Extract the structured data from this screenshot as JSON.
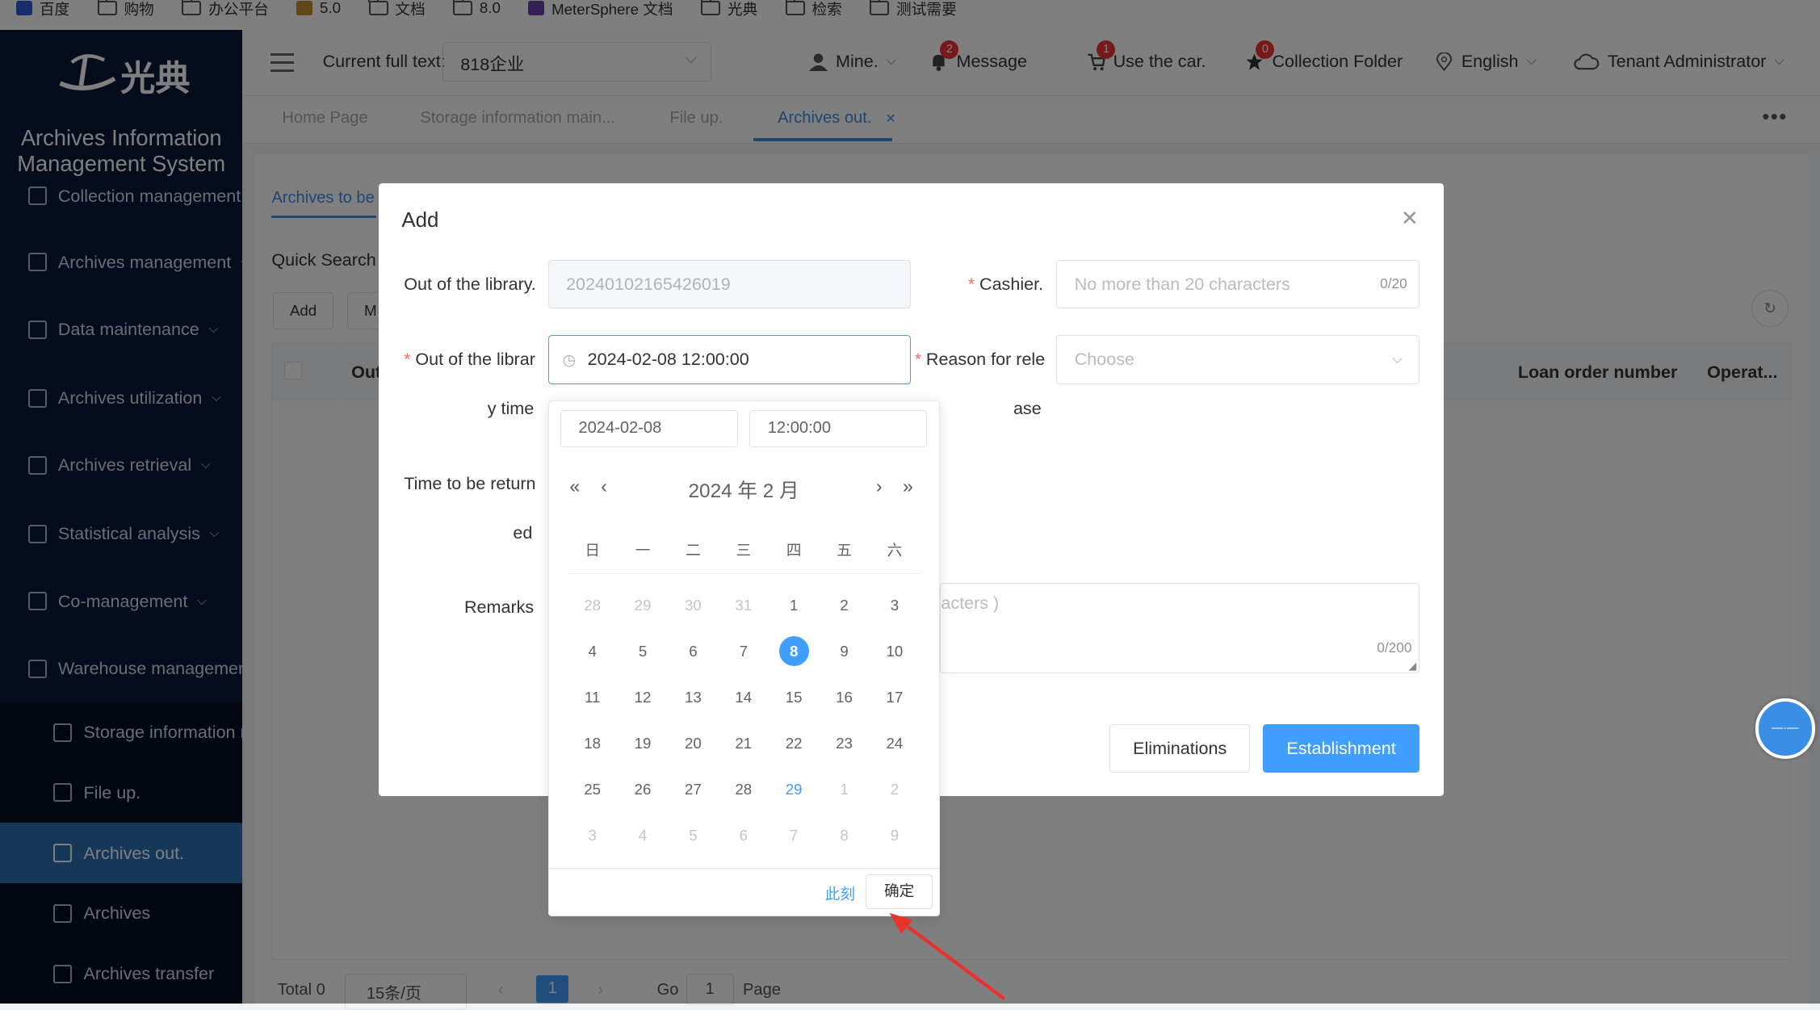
{
  "bookmarks": [
    {
      "label": "百度",
      "icon": "baidu-icon"
    },
    {
      "label": "购物",
      "icon": "folder-icon"
    },
    {
      "label": "办公平台",
      "icon": "folder-icon"
    },
    {
      "label": "5.0",
      "icon": "bookmark-icon"
    },
    {
      "label": "文档",
      "icon": "folder-icon"
    },
    {
      "label": "8.0",
      "icon": "folder-icon"
    },
    {
      "label": "MeterSphere 文档",
      "icon": "metersphere-icon"
    },
    {
      "label": "光典",
      "icon": "folder-icon"
    },
    {
      "label": "检索",
      "icon": "folder-icon"
    },
    {
      "label": "测试需要",
      "icon": "folder-icon"
    }
  ],
  "sidebar": {
    "logo_text": "光典",
    "title": "Archives Information Management System",
    "items": [
      {
        "label": "Collection management",
        "chevron": false
      },
      {
        "label": "Archives management",
        "chevron": true
      },
      {
        "label": "Data maintenance",
        "chevron": true
      },
      {
        "label": "Archives utilization",
        "chevron": true
      },
      {
        "label": "Archives retrieval",
        "chevron": true
      },
      {
        "label": "Statistical analysis",
        "chevron": true
      },
      {
        "label": "Co-management",
        "chevron": true
      },
      {
        "label": "Warehouse management",
        "chevron": true
      }
    ],
    "sub_items": [
      {
        "label": "Storage information maintenance",
        "active": false
      },
      {
        "label": "File up.",
        "active": false
      },
      {
        "label": "Archives out.",
        "active": true
      },
      {
        "label": "Archives",
        "active": false
      },
      {
        "label": "Archives transfer",
        "active": false
      }
    ]
  },
  "header": {
    "current_label": "Current full text:",
    "current_value": "818企业",
    "mine": "Mine.",
    "message": "Message",
    "message_badge": "2",
    "cart": "Use the car.",
    "cart_badge": "1",
    "collection": "Collection Folder",
    "collection_badge": "0",
    "language": "English",
    "user": "Tenant Administrator"
  },
  "tabs": [
    {
      "label": "Home Page",
      "active": false
    },
    {
      "label": "Storage information main...",
      "active": false
    },
    {
      "label": "File up.",
      "active": false
    },
    {
      "label": "Archives out.",
      "active": true
    }
  ],
  "content": {
    "sub_tab": "Archives to be",
    "quick_search": "Quick Search",
    "add_button": "Add",
    "second_button": "M",
    "columns": {
      "first": "Out",
      "loan": "Loan order number",
      "op": "Operat..."
    },
    "pager": {
      "total": "Total 0",
      "per_page": "15条/页",
      "page": "1",
      "go": "Go",
      "go_value": "1",
      "page_label": "Page"
    }
  },
  "dialog": {
    "title": "Add",
    "out_no_label": "Out of the library.",
    "out_no_value": "20240102165426019",
    "cashier_label": "Cashier.",
    "cashier_placeholder": "No more than 20 characters",
    "cashier_count": "0/20",
    "time_label_1": "Out of the librar",
    "time_label_2": "y time",
    "time_value": "2024-02-08 12:00:00",
    "reason_label_1": "Reason for rele",
    "reason_label_2": "ase",
    "reason_placeholder": "Choose",
    "return_label_1": "Time to be return",
    "return_label_2": "ed",
    "remarks_label": "Remarks",
    "remarks_placeholder": "acters )",
    "remarks_count": "0/200",
    "cancel": "Eliminations",
    "confirm": "Establishment"
  },
  "picker": {
    "date_value": "2024-02-08",
    "time_value": "12:00:00",
    "year_month": "2024 年  2 月",
    "weekdays": [
      "日",
      "一",
      "二",
      "三",
      "四",
      "五",
      "六"
    ],
    "weeks": [
      [
        {
          "d": "28",
          "k": "o"
        },
        {
          "d": "29",
          "k": "o"
        },
        {
          "d": "30",
          "k": "o"
        },
        {
          "d": "31",
          "k": "o"
        },
        {
          "d": "1",
          "k": ""
        },
        {
          "d": "2",
          "k": ""
        },
        {
          "d": "3",
          "k": ""
        }
      ],
      [
        {
          "d": "4",
          "k": ""
        },
        {
          "d": "5",
          "k": ""
        },
        {
          "d": "6",
          "k": ""
        },
        {
          "d": "7",
          "k": ""
        },
        {
          "d": "8",
          "k": "s"
        },
        {
          "d": "9",
          "k": ""
        },
        {
          "d": "10",
          "k": ""
        }
      ],
      [
        {
          "d": "11",
          "k": ""
        },
        {
          "d": "12",
          "k": ""
        },
        {
          "d": "13",
          "k": ""
        },
        {
          "d": "14",
          "k": ""
        },
        {
          "d": "15",
          "k": ""
        },
        {
          "d": "16",
          "k": ""
        },
        {
          "d": "17",
          "k": ""
        }
      ],
      [
        {
          "d": "18",
          "k": ""
        },
        {
          "d": "19",
          "k": ""
        },
        {
          "d": "20",
          "k": ""
        },
        {
          "d": "21",
          "k": ""
        },
        {
          "d": "22",
          "k": ""
        },
        {
          "d": "23",
          "k": ""
        },
        {
          "d": "24",
          "k": ""
        }
      ],
      [
        {
          "d": "25",
          "k": ""
        },
        {
          "d": "26",
          "k": ""
        },
        {
          "d": "27",
          "k": ""
        },
        {
          "d": "28",
          "k": ""
        },
        {
          "d": "29",
          "k": "t"
        },
        {
          "d": "1",
          "k": "o"
        },
        {
          "d": "2",
          "k": "o"
        }
      ],
      [
        {
          "d": "3",
          "k": "o"
        },
        {
          "d": "4",
          "k": "o"
        },
        {
          "d": "5",
          "k": "o"
        },
        {
          "d": "6",
          "k": "o"
        },
        {
          "d": "7",
          "k": "o"
        },
        {
          "d": "8",
          "k": "o"
        },
        {
          "d": "9",
          "k": "o"
        }
      ]
    ],
    "now": "此刻",
    "ok": "确定"
  },
  "colors": {
    "accent": "#409eff",
    "sidebar": "#0b1a3a",
    "active_menu": "#2f6fb3",
    "badge": "#e33333",
    "annotation_arrow": "#e8322c"
  }
}
